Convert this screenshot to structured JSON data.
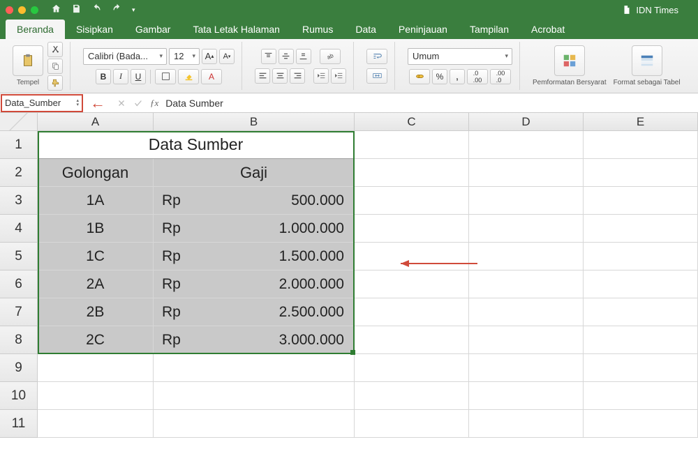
{
  "titlebar": {
    "doc_title": "IDN Times"
  },
  "tabs": [
    "Beranda",
    "Sisipkan",
    "Gambar",
    "Tata Letak Halaman",
    "Rumus",
    "Data",
    "Peninjauan",
    "Tampilan",
    "Acrobat"
  ],
  "active_tab": 0,
  "ribbon": {
    "paste_label": "Tempel",
    "font_name": "Calibri (Bada...",
    "font_size": "12",
    "number_format": "Umum",
    "cond_fmt": "Pemformatan Bersyarat",
    "fmt_table": "Format sebagai Tabel"
  },
  "formula_bar": {
    "name_box": "Data_Sumber",
    "formula": "Data Sumber"
  },
  "columns": [
    "A",
    "B",
    "C",
    "D",
    "E"
  ],
  "row_numbers": [
    1,
    2,
    3,
    4,
    5,
    6,
    7,
    8,
    9,
    10,
    11
  ],
  "sheet": {
    "title": "Data Sumber",
    "headers": {
      "col1": "Golongan",
      "col2": "Gaji"
    },
    "currency": "Rp",
    "rows": [
      {
        "gol": "1A",
        "gaji": "500.000"
      },
      {
        "gol": "1B",
        "gaji": "1.000.000"
      },
      {
        "gol": "1C",
        "gaji": "1.500.000"
      },
      {
        "gol": "2A",
        "gaji": "2.000.000"
      },
      {
        "gol": "2B",
        "gaji": "2.500.000"
      },
      {
        "gol": "2C",
        "gaji": "3.000.000"
      }
    ]
  }
}
